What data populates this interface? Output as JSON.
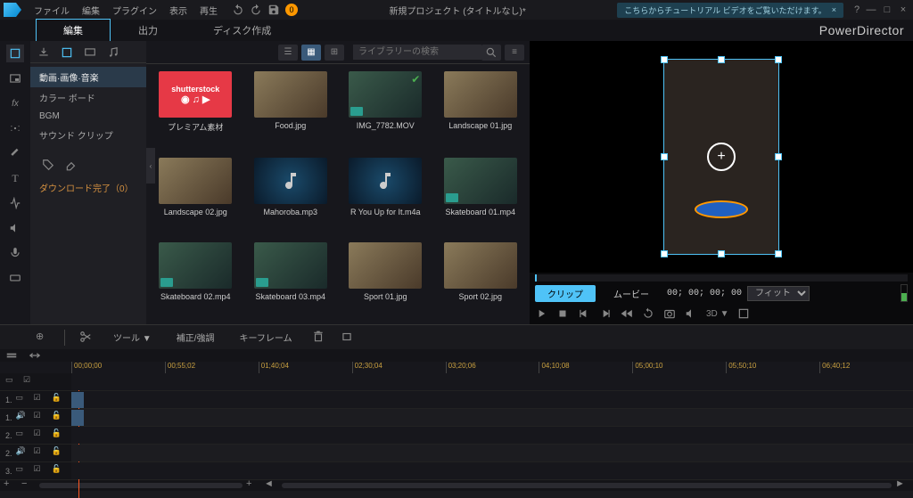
{
  "menu": [
    "ファイル",
    "編集",
    "プラグイン",
    "表示",
    "再生"
  ],
  "badge": "0",
  "title": "新規プロジェクト (タイトルなし)*",
  "notice": "こちらからチュートリアル ビデオをご覧いただけます。",
  "notice_close": "×",
  "brand": "PowerDirector",
  "main_tabs": {
    "edit": "編集",
    "output": "出力",
    "disc": "ディスク作成"
  },
  "sidebar": {
    "items": [
      "動画·画像·音楽",
      "カラー ボード",
      "BGM",
      "サウンド クリップ"
    ],
    "download": "ダウンロード完了（0）"
  },
  "library": {
    "search_placeholder": "ライブラリーの検索",
    "items": [
      {
        "label": "プレミアム素材",
        "kind": "shutterstock"
      },
      {
        "label": "Food.jpg",
        "kind": "image"
      },
      {
        "label": "IMG_7782.MOV",
        "kind": "video",
        "check": true
      },
      {
        "label": "Landscape 01.jpg",
        "kind": "image"
      },
      {
        "label": "Landscape 02.jpg",
        "kind": "image"
      },
      {
        "label": "Mahoroba.mp3",
        "kind": "audio"
      },
      {
        "label": "R You Up for It.m4a",
        "kind": "audio"
      },
      {
        "label": "Skateboard 01.mp4",
        "kind": "video"
      },
      {
        "label": "Skateboard 02.mp4",
        "kind": "video"
      },
      {
        "label": "Skateboard 03.mp4",
        "kind": "video"
      },
      {
        "label": "Sport 01.jpg",
        "kind": "image"
      },
      {
        "label": "Sport 02.jpg",
        "kind": "image"
      }
    ]
  },
  "preview": {
    "clip": "クリップ",
    "movie": "ムービー",
    "timecode": "00; 00; 00; 00",
    "fit": "フィット",
    "three_d": "3D"
  },
  "timeline_toolbar": {
    "tool": "ツール",
    "correct": "補正/強調",
    "keyframe": "キーフレーム"
  },
  "ruler": [
    "00;00;00",
    "00;55;02",
    "01;40;04",
    "02;30;04",
    "03;20;06",
    "04;10;08",
    "05;00;10",
    "05;50;10",
    "06;40;12"
  ],
  "tracks": [
    "1.",
    "1.",
    "2.",
    "2.",
    "3."
  ]
}
